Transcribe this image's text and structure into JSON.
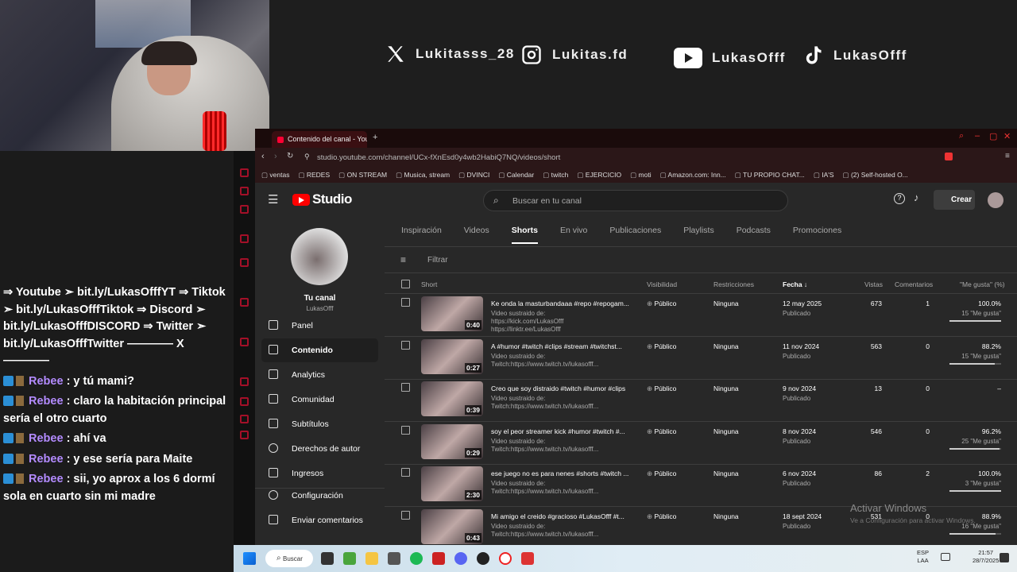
{
  "socials": {
    "twitter": "Lukitasss_28",
    "instagram": "Lukitas.fd",
    "youtube": "LukasOfff",
    "tiktok": "LukasOfff"
  },
  "chat": {
    "links_text": "⇒ Youtube ➣ bit.ly/LukasOfffYT ⇒ Tiktok ➣ bit.ly/LukasOfffTiktok ⇒ Discord ➣ bit.ly/LukasOfffDISCORD ⇒ Twitter ➣ bit.ly/LukasOfffTwitter ———— X ————",
    "messages": [
      {
        "user": "Rebee",
        "text": ": y tú mami?"
      },
      {
        "user": "Rebee",
        "text": ": claro la habitación principal sería el otro cuarto"
      },
      {
        "user": "Rebee",
        "text": ": ahí va"
      },
      {
        "user": "Rebee",
        "text": ": y ese sería para Maite"
      },
      {
        "user": "Rebee",
        "text": ": sii, yo aprox a los 6 dormí sola en cuarto sin mi madre"
      }
    ]
  },
  "browser": {
    "tab_title": "Contenido del canal - You",
    "url": "studio.youtube.com/channel/UCx-fXnEsd0y4wb2HabiQ7NQ/videos/short",
    "bookmarks": [
      "ventas",
      "REDES",
      "ON STREAM",
      "Musica, stream",
      "DVINCI",
      "Calendar",
      "twitch",
      "EJERCICIO",
      "moti",
      "Amazon.com: Inn...",
      "TU PROPIO CHAT...",
      "IA'S",
      "(2) Self-hosted O..."
    ]
  },
  "studio": {
    "logo": "Studio",
    "search_placeholder": "Buscar en tu canal",
    "create_label": "Crear",
    "channel_title": "Tu canal",
    "channel_handle": "LukasOfff",
    "nav": [
      "Panel",
      "Contenido",
      "Analytics",
      "Comunidad",
      "Subtítulos",
      "Derechos de autor",
      "Ingresos",
      "Configuración",
      "Enviar comentarios"
    ],
    "tabs": [
      "Inspiración",
      "Videos",
      "Shorts",
      "En vivo",
      "Publicaciones",
      "Playlists",
      "Podcasts",
      "Promociones"
    ],
    "filter_placeholder": "Filtrar",
    "columns": {
      "short": "Short",
      "visibility": "Visibilidad",
      "restrictions": "Restricciones",
      "date": "Fecha ↓",
      "views": "Vistas",
      "comments": "Comentarios",
      "likes": "\"Me gusta\" (%)"
    },
    "rows": [
      {
        "duration": "0:40",
        "title": "Ke onda la masturbandaaa #repo #repogam...",
        "desc": "Video sustraido de: https://kick.com/LukasOfff https://linktr.ee/LukasOfff",
        "visibility": "Público",
        "restrictions": "Ninguna",
        "date": "12 may 2025",
        "status": "Publicado",
        "views": "673",
        "comments": "1",
        "pct": "100.0%",
        "likes": "15 \"Me gusta\"",
        "ratio": 1.0
      },
      {
        "duration": "0:27",
        "title": "A #humor #twitch #clips #stream #twitchst...",
        "desc": "Video sustraido de: Twitch:https://www.twitch.tv/lukasofff...",
        "visibility": "Público",
        "restrictions": "Ninguna",
        "date": "11 nov 2024",
        "status": "Publicado",
        "views": "563",
        "comments": "0",
        "pct": "88.2%",
        "likes": "15 \"Me gusta\"",
        "ratio": 0.882
      },
      {
        "duration": "0:39",
        "title": "Creo que soy distraido #twitch #humor #clips",
        "desc": "Video sustraido de: Twitch:https://www.twitch.tv/lukasofff...",
        "visibility": "Público",
        "restrictions": "Ninguna",
        "date": "9 nov 2024",
        "status": "Publicado",
        "views": "13",
        "comments": "0",
        "pct": "–",
        "likes": "",
        "ratio": 0
      },
      {
        "duration": "0:29",
        "title": "soy el peor streamer kick #humor #twitch #...",
        "desc": "Video sustraido de: Twitch:https://www.twitch.tv/lukasofff...",
        "visibility": "Público",
        "restrictions": "Ninguna",
        "date": "8 nov 2024",
        "status": "Publicado",
        "views": "546",
        "comments": "0",
        "pct": "96.2%",
        "likes": "25 \"Me gusta\"",
        "ratio": 0.962
      },
      {
        "duration": "2:30",
        "title": "ese juego no es para nenes #shorts #twitch ...",
        "desc": "Video sustraido de: Twitch:https://www.twitch.tv/lukasofff...",
        "visibility": "Público",
        "restrictions": "Ninguna",
        "date": "6 nov 2024",
        "status": "Publicado",
        "views": "86",
        "comments": "2",
        "pct": "100.0%",
        "likes": "3 \"Me gusta\"",
        "ratio": 1.0
      },
      {
        "duration": "0:43",
        "title": "Mi amigo el creido #gracioso #LukasOfff #t...",
        "desc": "Video sustraido de: Twitch:https://www.twitch.tv/lukasofff...",
        "visibility": "Público",
        "restrictions": "Ninguna",
        "date": "18 sept 2024",
        "status": "Publicado",
        "views": "531",
        "comments": "0",
        "pct": "88.9%",
        "likes": "16 \"Me gusta\"",
        "ratio": 0.889
      }
    ]
  },
  "windows": {
    "watermark_title": "Activar Windows",
    "watermark_sub": "Ve a Configuración para activar Windows.",
    "taskbar_search": "Buscar",
    "lang": "ESP\nLAA",
    "time": "21:57",
    "date": "28/7/2025"
  },
  "colors": {
    "youtube_red": "#ff0000",
    "accent_red": "#c8102e"
  }
}
